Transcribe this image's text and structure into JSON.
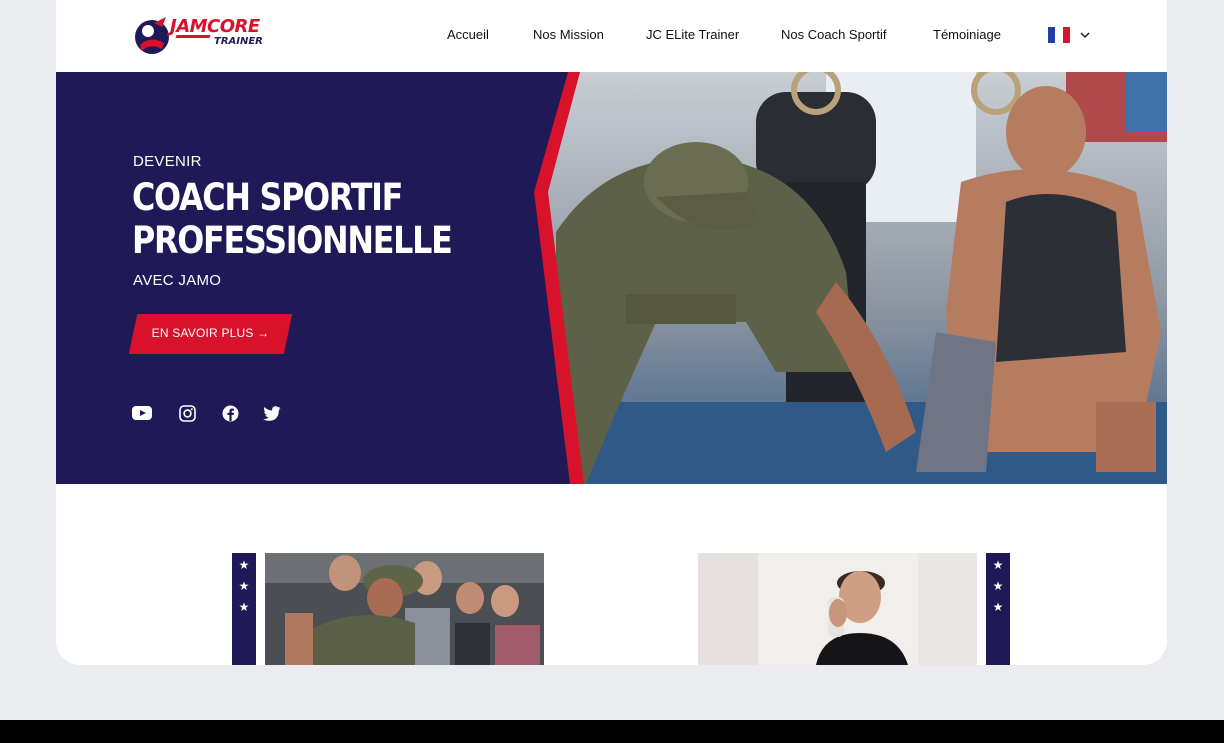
{
  "brand": {
    "name": "JAMCORE",
    "tagline": "TRAINER",
    "colors": {
      "navy": "#1f1957",
      "red": "#d9122b"
    }
  },
  "nav": {
    "items": [
      {
        "label": "Accueil"
      },
      {
        "label": "Nos Mission"
      },
      {
        "label": "JC ELite Trainer"
      },
      {
        "label": "Nos Coach Sportif"
      },
      {
        "label": "Témoiniage"
      }
    ],
    "language": {
      "flag": "flag-fr-icon",
      "chevron": "chevron-down-icon"
    }
  },
  "hero": {
    "kicker": "DEVENIR",
    "title_line1": "COACH SPORTIF",
    "title_line2": "PROFESSIONNELLE",
    "subtitle": "AVEC JAMO",
    "cta_label": "EN SAVOIR PLUS →",
    "social": [
      {
        "icon": "youtube-icon"
      },
      {
        "icon": "instagram-icon"
      },
      {
        "icon": "facebook-icon"
      },
      {
        "icon": "twitter-icon"
      }
    ]
  },
  "cards": [
    {
      "image": "coach-demonstration-photo",
      "stars": [
        "★",
        "★",
        "★"
      ]
    },
    {
      "image": "coach-on-phone-photo",
      "stars": [
        "★",
        "★",
        "★"
      ]
    }
  ]
}
